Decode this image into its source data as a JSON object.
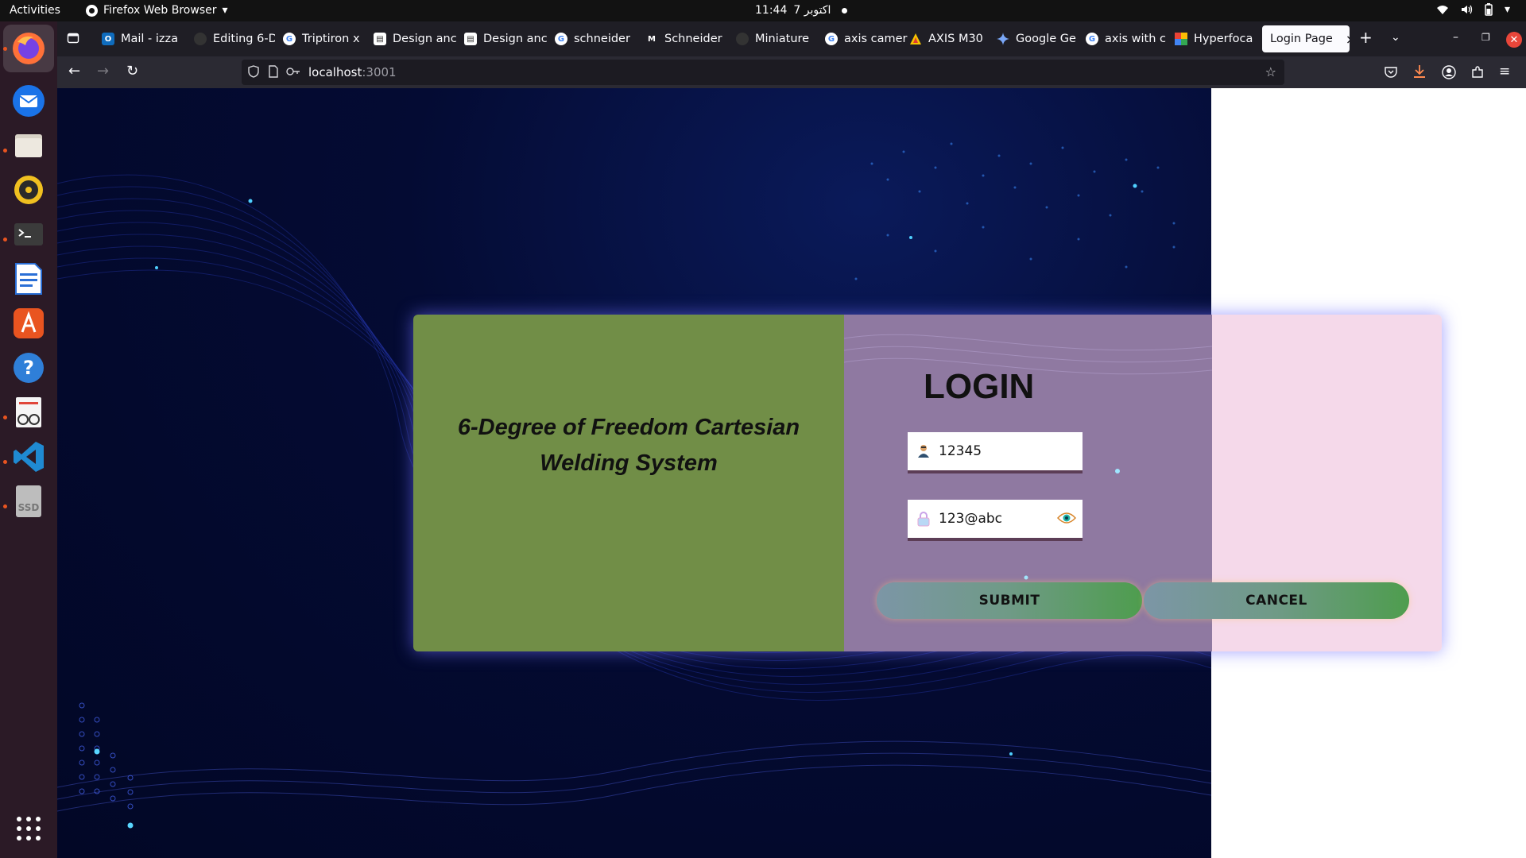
{
  "topbar": {
    "activities": "Activities",
    "app_name": "Firefox Web Browser",
    "clock": "11:44",
    "date": "7 اکتوبر"
  },
  "dock": {
    "items": [
      "firefox",
      "thunderbird",
      "files",
      "rhythmbox",
      "terminal",
      "writer",
      "app-center",
      "help",
      "document-viewer",
      "vscode",
      "ssd-drive"
    ],
    "ssd_label": "SSD"
  },
  "browser": {
    "tabs": [
      {
        "label": "Mail - izza",
        "icon": "outlook-icon"
      },
      {
        "label": "Editing 6-D",
        "icon": "github-icon"
      },
      {
        "label": "Triptiron x",
        "icon": "google-icon"
      },
      {
        "label": "Design anc",
        "icon": "docs-icon"
      },
      {
        "label": "Design anc",
        "icon": "docs-icon"
      },
      {
        "label": "schneider",
        "icon": "google-icon"
      },
      {
        "label": "Schneider",
        "icon": "gmail-icon"
      },
      {
        "label": "Miniature",
        "icon": "github-icon"
      },
      {
        "label": "axis camer",
        "icon": "google-icon"
      },
      {
        "label": "AXIS M30",
        "icon": "axis-icon"
      },
      {
        "label": "Google Ge",
        "icon": "gemini-icon"
      },
      {
        "label": "axis with c",
        "icon": "google-icon"
      },
      {
        "label": "Hyperfoca",
        "icon": "hyperfocal-icon"
      },
      {
        "label": "Login Page",
        "icon": "",
        "active": true
      }
    ],
    "url_host": "localhost",
    "url_port": ":3001"
  },
  "page": {
    "system_title": "6-Degree of Freedom Cartesian Welding System",
    "login_title": "LOGIN",
    "username": "12345",
    "password": "123@abc",
    "submit_label": "SUBMIT",
    "cancel_label": "CANCEL"
  }
}
